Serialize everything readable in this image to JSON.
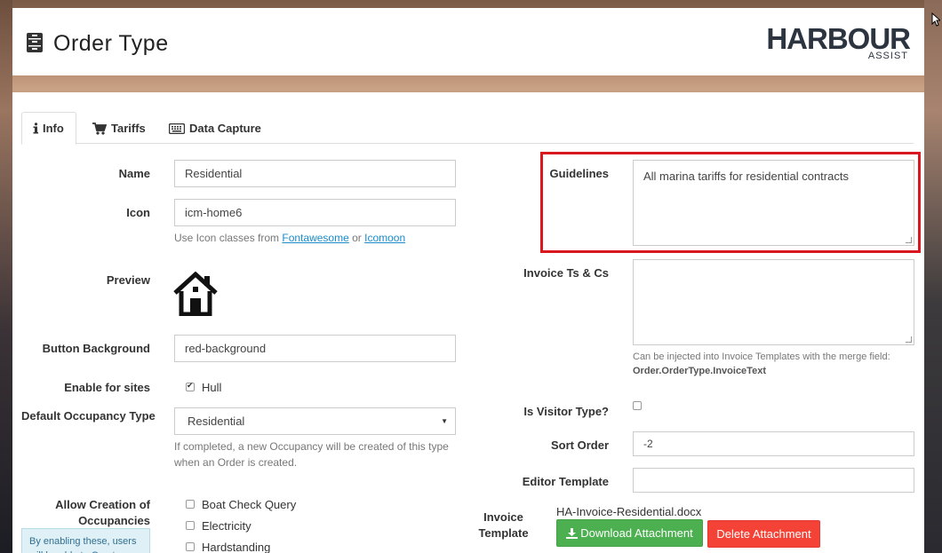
{
  "header": {
    "title": "Order Type",
    "logo_text": "HARBOUR",
    "logo_sub": "ASSIST"
  },
  "tabs": [
    {
      "label": "Info",
      "icon": "info-icon"
    },
    {
      "label": "Tariffs",
      "icon": "cart-icon"
    },
    {
      "label": "Data Capture",
      "icon": "keyboard-icon"
    }
  ],
  "form": {
    "name": {
      "label": "Name",
      "value": "Residential"
    },
    "icon": {
      "label": "Icon",
      "value": "icm-home6",
      "help_prefix": "Use Icon classes from",
      "link1": "Fontawesome",
      "help_or": "or",
      "link2": "Icomoon"
    },
    "preview": {
      "label": "Preview",
      "icon": "home-icon"
    },
    "button_background": {
      "label": "Button Background",
      "value": "red-background"
    },
    "enable_sites": {
      "label": "Enable for sites",
      "option": "Hull",
      "checked": true
    },
    "default_occupancy": {
      "label": "Default Occupancy Type",
      "value": "Residential",
      "help": "If completed, a new Occupancy will be created of this type when an Order is created."
    },
    "allow_creation": {
      "label_line1": "Allow Creation of",
      "label_line2": "Occupancies",
      "options": [
        "Boat Check Query",
        "Electricity",
        "Hardstanding"
      ],
      "note": "By enabling these, users will be able to Create"
    },
    "guidelines": {
      "label": "Guidelines",
      "value": "All marina tariffs for residential contracts"
    },
    "invoice_ts": {
      "label": "Invoice Ts & Cs",
      "value": "",
      "help": "Can be injected into Invoice Templates with the merge field:",
      "help_field": "Order.OrderType.InvoiceText"
    },
    "is_visitor": {
      "label": "Is Visitor Type?",
      "checked": false
    },
    "sort_order": {
      "label": "Sort Order",
      "value": "-2"
    },
    "editor_template": {
      "label": "Editor Template",
      "value": ""
    },
    "invoice_template": {
      "label_line1": "Invoice",
      "label_line2": "Template",
      "file": "HA-Invoice-Residential.docx",
      "download_label": "Download Attachment",
      "delete_label": "Delete Attachment"
    }
  },
  "colors": {
    "highlight": "#d9171f",
    "green": "#4caf50",
    "red": "#f44336",
    "link": "#1a8ccc"
  }
}
